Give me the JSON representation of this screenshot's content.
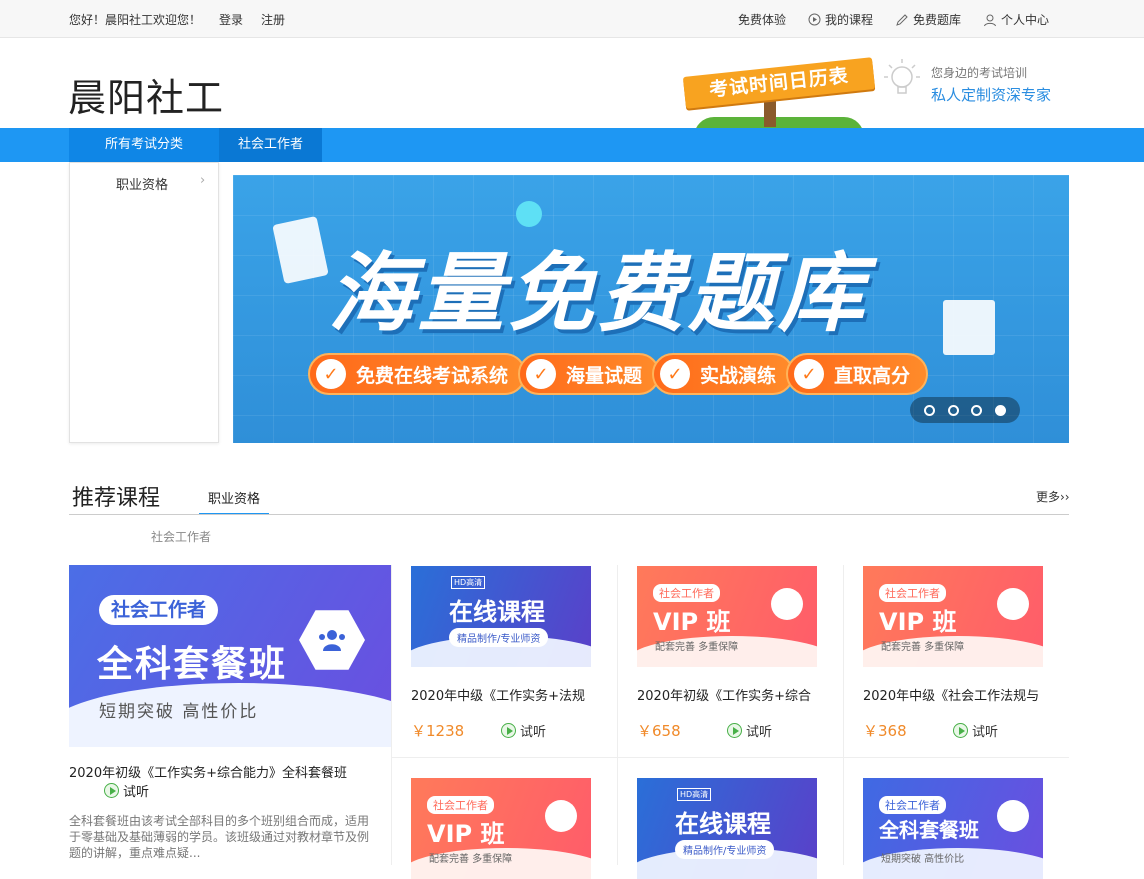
{
  "topbar": {
    "greeting": "您好！晨阳社工欢迎您！",
    "login": "登录",
    "register": "注册",
    "links": [
      {
        "label": "免费体验",
        "icon": "none"
      },
      {
        "label": "我的课程",
        "icon": "play-circle-icon"
      },
      {
        "label": "免费题库",
        "icon": "pencil-icon"
      },
      {
        "label": "个人中心",
        "icon": "user-icon"
      }
    ]
  },
  "header": {
    "logo": "晨阳社工",
    "calendar_sign": "考试时间日历表",
    "slogan_small": "您身边的考试培训",
    "slogan_big": "私人定制资深专家"
  },
  "nav": {
    "all_categories": "所有考试分类",
    "tab": "社会工作者"
  },
  "sidemenu": {
    "items": [
      {
        "label": "职业资格",
        "chevron": "›"
      }
    ]
  },
  "banner": {
    "title": "海量免费题库",
    "pills": [
      "免费在线考试系统",
      "海量试题",
      "实战演练",
      "直取高分"
    ],
    "check": "✓",
    "dots": 4,
    "active_dot": 3
  },
  "recommended": {
    "title": "推荐课程",
    "tab": "职业资格",
    "more": "更多››",
    "subcategory": "社会工作者",
    "featured": {
      "badge": "社会工作者",
      "big": "全科套餐班",
      "small": "短期突破  高性价比",
      "title": "2020年初级《工作实务+综合能力》全科套餐班",
      "trial": "试听",
      "desc": "全科套餐班由该考试全部科目的多个班别组合而成，适用于零基础及基础薄弱的学员。该班级通过对教材章节及例题的讲解，重点难点疑..."
    },
    "cards": [
      {
        "type": "online",
        "hd": "HD高清",
        "line1": "在线课程",
        "line2": "精品制作/专业师资",
        "title": "2020年中级《工作实务+法规",
        "price": "￥1238",
        "trial": "试听"
      },
      {
        "type": "vip",
        "badge": "社会工作者",
        "line1": "VIP 班",
        "line2": "配套完善  多重保障",
        "logo": "VIP",
        "title": "2020年初级《工作实务+综合",
        "price": "￥658",
        "trial": "试听"
      },
      {
        "type": "vip",
        "badge": "社会工作者",
        "line1": "VIP 班",
        "line2": "配套完善  多重保障",
        "logo": "VIP",
        "title": "2020年中级《社会工作法规与",
        "price": "￥368",
        "trial": "试听"
      },
      {
        "type": "vip",
        "badge": "社会工作者",
        "line1": "VIP 班",
        "line2": "配套完善  多重保障",
        "logo": "VIP"
      },
      {
        "type": "online",
        "hd": "HD高清",
        "line1": "在线课程",
        "line2": "精品制作/专业师资"
      },
      {
        "type": "full",
        "badge": "社会工作者",
        "line1": "全科套餐班",
        "line2": "短期突破  高性价比"
      }
    ]
  }
}
